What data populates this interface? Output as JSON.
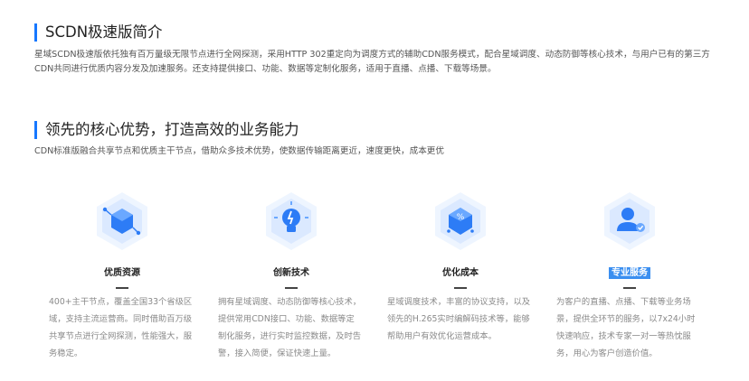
{
  "intro": {
    "title": "SCDN极速版简介",
    "text": "星域SCDN极速版依托独有百万量级无限节点进行全网探测，采用HTTP 302重定向为调度方式的辅助CDN服务模式，配合星域调度、动态防御等核心技术，与用户已有的第三方CDN共同进行优质内容分发及加速服务。还支持提供接口、功能、数据等定制化服务，适用于直播、点播、下载等场景。"
  },
  "advantages": {
    "title": "领先的核心优势，打造高效的业务能力",
    "subtitle": "CDN标准版融合共享节点和优质主干节点，借助众多技术优势，使数据传输距离更近，速度更快，成本更优"
  },
  "features": [
    {
      "icon": "cube-network-icon",
      "title": "优质资源",
      "desc": "400+主干节点，覆盖全国33个省级区域，支持主流运营商。同时借助百万级共享节点进行全网探测，性能强大，服务稳定。"
    },
    {
      "icon": "lightbulb-icon",
      "title": "创新技术",
      "desc": "拥有星域调度、动态防御等核心技术，提供常用CDN接口、功能、数据等定制化服务，进行实时监控数据，及时告警，接入简便，保证快速上量。"
    },
    {
      "icon": "percent-chip-icon",
      "title": "优化成本",
      "desc": "星域调度技术，丰富的协议支持，以及领先的H.265实时编解码技术等，能够帮助用户有效优化运营成本。"
    },
    {
      "icon": "user-service-icon",
      "title": "专业服务",
      "desc": "为客户的直播、点播、下载等业务场景，提供全环节的服务，以7x24小时快速响应，技术专家一对一等热忱服务，用心为客户创造价值。"
    }
  ],
  "colors": {
    "accent": "#1677ff",
    "icon_blue": "#2d7cf6",
    "hex_light": "#eef5ff"
  }
}
